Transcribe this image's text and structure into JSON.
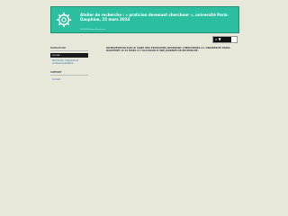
{
  "header": {
    "title": "Atelier de recherche : « praticien devenant chercheur », université Paris-Dauphine, 25 mars 2024",
    "subtitle": "25/03/2024 dans Recherche"
  },
  "search": {
    "button_label": "⌕ ▼",
    "placeholder": ""
  },
  "sidebar": {
    "sections": [
      {
        "heading": "NAVIGATION",
        "items": [
          {
            "label": "Accueil",
            "active": true
          },
          {
            "label": "Recherche, ingénierie et professionnalisation",
            "active": false
          }
        ]
      },
      {
        "heading": "SUPPORT",
        "items": [
          {
            "label": "Contact",
            "active": false
          }
        ]
      }
    ]
  },
  "content": {
    "intro": "INTERVENTION SUR LE SUJET DES PRATICIENS DEVENANT CHERCHEURS À L'UNIVERSITÉ PARIS-DAUPHINE LE 25 MARS À L'OCCASION D'UNE JOURNÉE DE RECHERCHE."
  },
  "colors": {
    "header_bg": "#2bbfa0",
    "page_bg": "#e8e8da",
    "active_item_bg": "#1a1a1a"
  }
}
